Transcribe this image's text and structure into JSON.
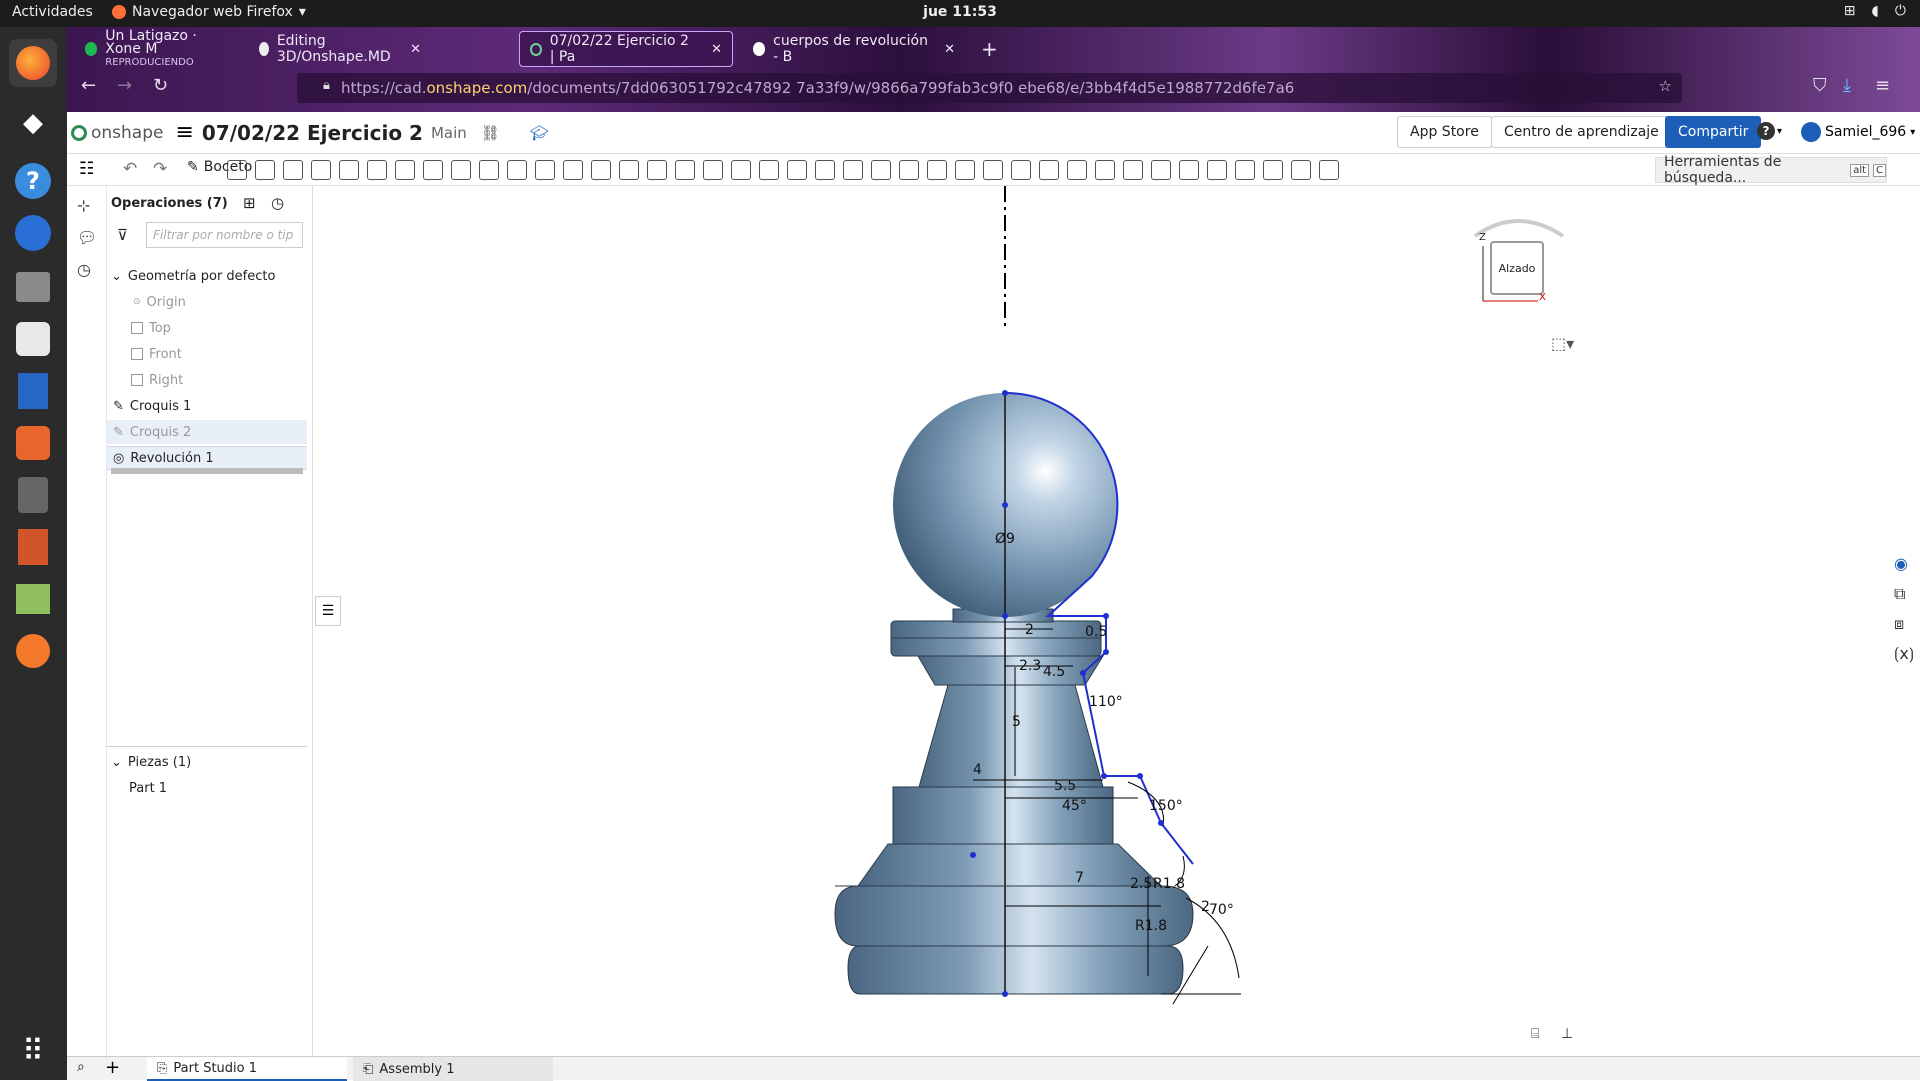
{
  "system": {
    "activities": "Actividades",
    "app_name": "Navegador web Firefox",
    "clock": "jue 11:53"
  },
  "browser": {
    "tabs": [
      {
        "label": "Un Latigazo · Xone M",
        "sub": "REPRODUCIENDO"
      },
      {
        "label": "Editing 3D/Onshape.MD"
      },
      {
        "label": "07/02/22 Ejercicio 2 | Pa"
      },
      {
        "label": "cuerpos de revolución - B"
      }
    ],
    "url_prefix": "https://cad.",
    "url_domain": "onshape.com",
    "url_rest": "/documents/7dd063051792c47892 7a33f9/w/9866a799fab3c9f0 ebe68/e/3bb4f4d5e1988772d6fe7a6"
  },
  "onshape": {
    "brand": "onshape",
    "doc_title": "07/02/22 Ejercicio 2",
    "branch": "Main",
    "app_store": "App Store",
    "learning": "Centro de aprendizaje",
    "share": "Compartir",
    "help": "?",
    "user": "Samiel_696",
    "sketch_label": "Boceto",
    "search_tools": "Herramientas de búsqueda...",
    "search_shortcut_1": "alt",
    "search_shortcut_2": "C"
  },
  "features": {
    "header": "Operaciones (7)",
    "filter_placeholder": "Filtrar por nombre o tip",
    "default_geometry": "Geometría por defecto",
    "items": [
      {
        "label": "Origin"
      },
      {
        "label": "Top"
      },
      {
        "label": "Front"
      },
      {
        "label": "Right"
      },
      {
        "label": "Croquis 1"
      },
      {
        "label": "Croquis 2"
      },
      {
        "label": "Revolución 1"
      }
    ],
    "parts_header": "Piezas (1)",
    "parts": [
      {
        "label": "Part 1"
      }
    ]
  },
  "viewcube": {
    "face": "Alzado",
    "axis_z": "Z",
    "axis_x": "X"
  },
  "dimensions": {
    "d1": "Ø9",
    "d2": "2",
    "d3": "0.5",
    "d4": "2.3",
    "d5": "4.5",
    "d6": "110°",
    "d7": "5",
    "d8": "4",
    "d9": "5.5",
    "d10": "45°",
    "d11": "150°",
    "d12": "7",
    "d13": "2.5",
    "d14": "R1.8",
    "d15": "2",
    "d16": "70°",
    "d17": "R1.8"
  },
  "bottom_tabs": [
    {
      "label": "Part Studio 1"
    },
    {
      "label": "Assembly 1"
    }
  ],
  "colors": {
    "accent": "#1d5fb8",
    "part_fill": "#7f9cb4",
    "sketch_line": "#1f2fd0"
  }
}
